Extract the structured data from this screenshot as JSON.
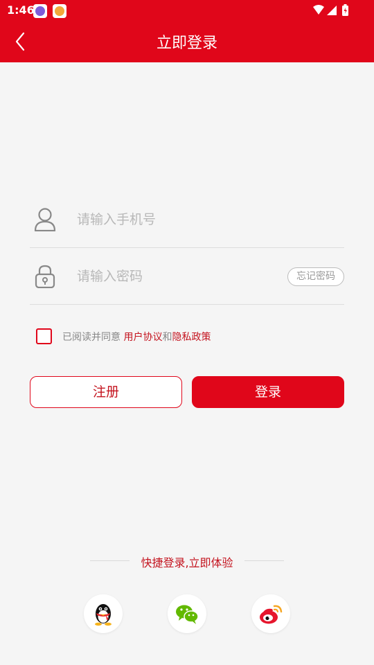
{
  "status_bar": {
    "time": "1:46"
  },
  "header": {
    "title": "立即登录"
  },
  "form": {
    "phone_placeholder": "请输入手机号",
    "password_placeholder": "请输入密码",
    "forgot_label": "忘记密码"
  },
  "agreement": {
    "prefix": "已阅读并同意 ",
    "user_agreement": "用户协议",
    "and": "和",
    "privacy_policy": "隐私政策"
  },
  "buttons": {
    "register": "注册",
    "login": "登录"
  },
  "quick_login": {
    "label": "快捷登录,立即体验",
    "providers": [
      "qq-icon",
      "wechat-icon",
      "weibo-icon"
    ]
  },
  "colors": {
    "brand": "#e0061a",
    "link": "#c4141f",
    "background": "#f5f5f5"
  }
}
